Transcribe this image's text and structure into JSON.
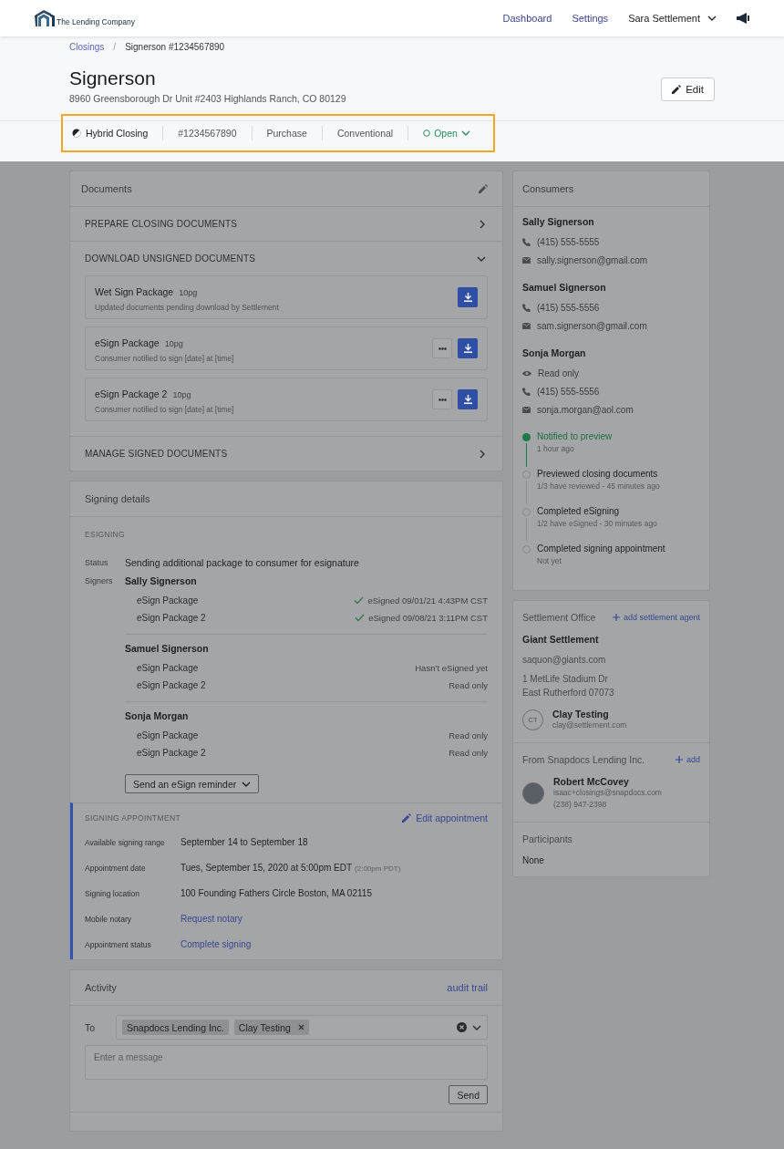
{
  "header": {
    "logo_text": "The Lending Company",
    "nav": [
      "Dashboard",
      "Settings"
    ],
    "user": "Sara Settlement"
  },
  "breadcrumb": {
    "items": [
      {
        "label": "Closings",
        "kind": "link"
      },
      {
        "label": "Signerson #1234567890",
        "kind": "current"
      }
    ],
    "separator": "/"
  },
  "title": "Signerson",
  "address": "8960 Greensborough Dr Unit #2403 Highlands Ranch, CO 80129",
  "edit_button": "Edit",
  "meta": [
    {
      "label": "Hybrid Closing",
      "kind": "type"
    },
    {
      "label": "#1234567890",
      "kind": "plain"
    },
    {
      "label": "Purchase",
      "kind": "plain"
    },
    {
      "label": "Conventional",
      "kind": "plain"
    },
    {
      "label": "Open",
      "kind": "status"
    }
  ],
  "documents": {
    "title": "Documents",
    "sections": [
      {
        "label": "PREPARE CLOSING DOCUMENTS",
        "expanded": false
      },
      {
        "label": "DOWNLOAD UNSIGNED DOCUMENTS",
        "expanded": true,
        "packages": [
          {
            "name": "Wet Sign Package",
            "pages": "10pg",
            "note": "Updated documents pending download by Settlement",
            "has_menu": false
          },
          {
            "name": "eSign Package",
            "pages": "10pg",
            "note": "Consumer notified to sign [date] at [time]",
            "has_menu": true
          },
          {
            "name": "eSign Package 2",
            "pages": "10pg",
            "note": "Consumer notified to sign [date] at [time]",
            "has_menu": true
          }
        ]
      },
      {
        "label": "MANAGE SIGNED DOCUMENTS",
        "expanded": false
      }
    ]
  },
  "signing_details": {
    "title": "Signing details",
    "section": "ESIGNING",
    "status_label": "Status",
    "status": "Sending additional package to consumer for esignature",
    "signers_label": "Signers",
    "signers": [
      {
        "name": "Sally Signerson",
        "packages": [
          {
            "name": "eSign Package",
            "status": "eSigned 09/01/21 4:43PM CST",
            "signed": true
          },
          {
            "name": "eSign Package 2",
            "status": "eSigned 09/08/21 3:11PM CST",
            "signed": true
          }
        ]
      },
      {
        "name": "Samuel Signerson",
        "packages": [
          {
            "name": "eSign Package",
            "status": "Hasn’t eSigned yet",
            "signed": false
          },
          {
            "name": "eSign Package 2",
            "status": "Read only",
            "signed": false
          }
        ]
      },
      {
        "name": "Sonja Morgan",
        "packages": [
          {
            "name": "eSign Package",
            "status": "Read only",
            "signed": false
          },
          {
            "name": "eSign Package 2",
            "status": "Read only",
            "signed": false
          }
        ]
      }
    ],
    "reminder_button": "Send an eSign reminder"
  },
  "appointment": {
    "title": "SIGNING APPOINTMENT",
    "edit_link": "Edit appointment",
    "rows": [
      {
        "label": "Available signing range",
        "value": "September 14 to September 18",
        "kind": "text"
      },
      {
        "label": "Appointment date",
        "value": "Tues, September 15, 2020 at 5:00pm EDT",
        "note": "(2:00pm PDT)",
        "kind": "text"
      },
      {
        "label": "Signing location",
        "value": "100 Founding Fathers Circle Boston, MA 02115",
        "kind": "text"
      },
      {
        "label": "Mobile notary",
        "value": "Request notary",
        "kind": "link"
      },
      {
        "label": "Appointment status",
        "value": "Complete signing",
        "kind": "link"
      }
    ]
  },
  "activity": {
    "title": "Activity",
    "audit_link": "audit trail",
    "to_label": "To",
    "recipients": [
      {
        "label": "Snapdocs Lending Inc.",
        "removable": false
      },
      {
        "label": "Clay Testing",
        "removable": true
      }
    ],
    "message_placeholder": "Enter a message",
    "send_button": "Send"
  },
  "consumers": {
    "title": "Consumers",
    "people": [
      {
        "name": "Sally Signerson",
        "lines": [
          {
            "kind": "phone",
            "text": "(415) 555-5555"
          },
          {
            "kind": "email",
            "text": "sally.signerson@gmail.com"
          }
        ]
      },
      {
        "name": "Samuel Signerson",
        "lines": [
          {
            "kind": "phone",
            "text": "(415) 555-5556"
          },
          {
            "kind": "email",
            "text": "sam.signerson@gmail.com"
          }
        ]
      },
      {
        "name": "Sonja Morgan",
        "lines": [
          {
            "kind": "access",
            "text": "Read only"
          },
          {
            "kind": "phone",
            "text": "(415) 555-5556"
          },
          {
            "kind": "email",
            "text": "sonja.morgan@aol.com"
          }
        ]
      }
    ],
    "timeline": [
      {
        "title": "Notified to preview",
        "detail": "1 hour ago",
        "done": true
      },
      {
        "title": "Previewed closing documents",
        "detail": "1/3 have reviewed - 45 minutes ago",
        "done": false
      },
      {
        "title": "Completed eSigning",
        "detail": "1/2 have eSigned - 30 minutes ago",
        "done": false
      },
      {
        "title": "Completed signing appointment",
        "detail": "Not yet",
        "done": false
      }
    ]
  },
  "settlement_office": {
    "title": "Settlement Office",
    "add_link": "add settlement agent",
    "company": "Giant Settlement",
    "email": "saquon@giants.com",
    "address_lines": [
      "1 MetLife Stadium Dr",
      "East Rutherford 07073"
    ],
    "agent": {
      "initials": "CT",
      "name": "Clay Testing",
      "email": "clay@settlement.com"
    }
  },
  "lender": {
    "title": "From Snapdocs Lending Inc.",
    "add_link": "add",
    "contact": {
      "name": "Robert McCovey",
      "email": "isaac+closings@snapdocs.com",
      "phone": "(238) 947-2398"
    }
  },
  "participants": {
    "title": "Participants",
    "value": "None"
  }
}
